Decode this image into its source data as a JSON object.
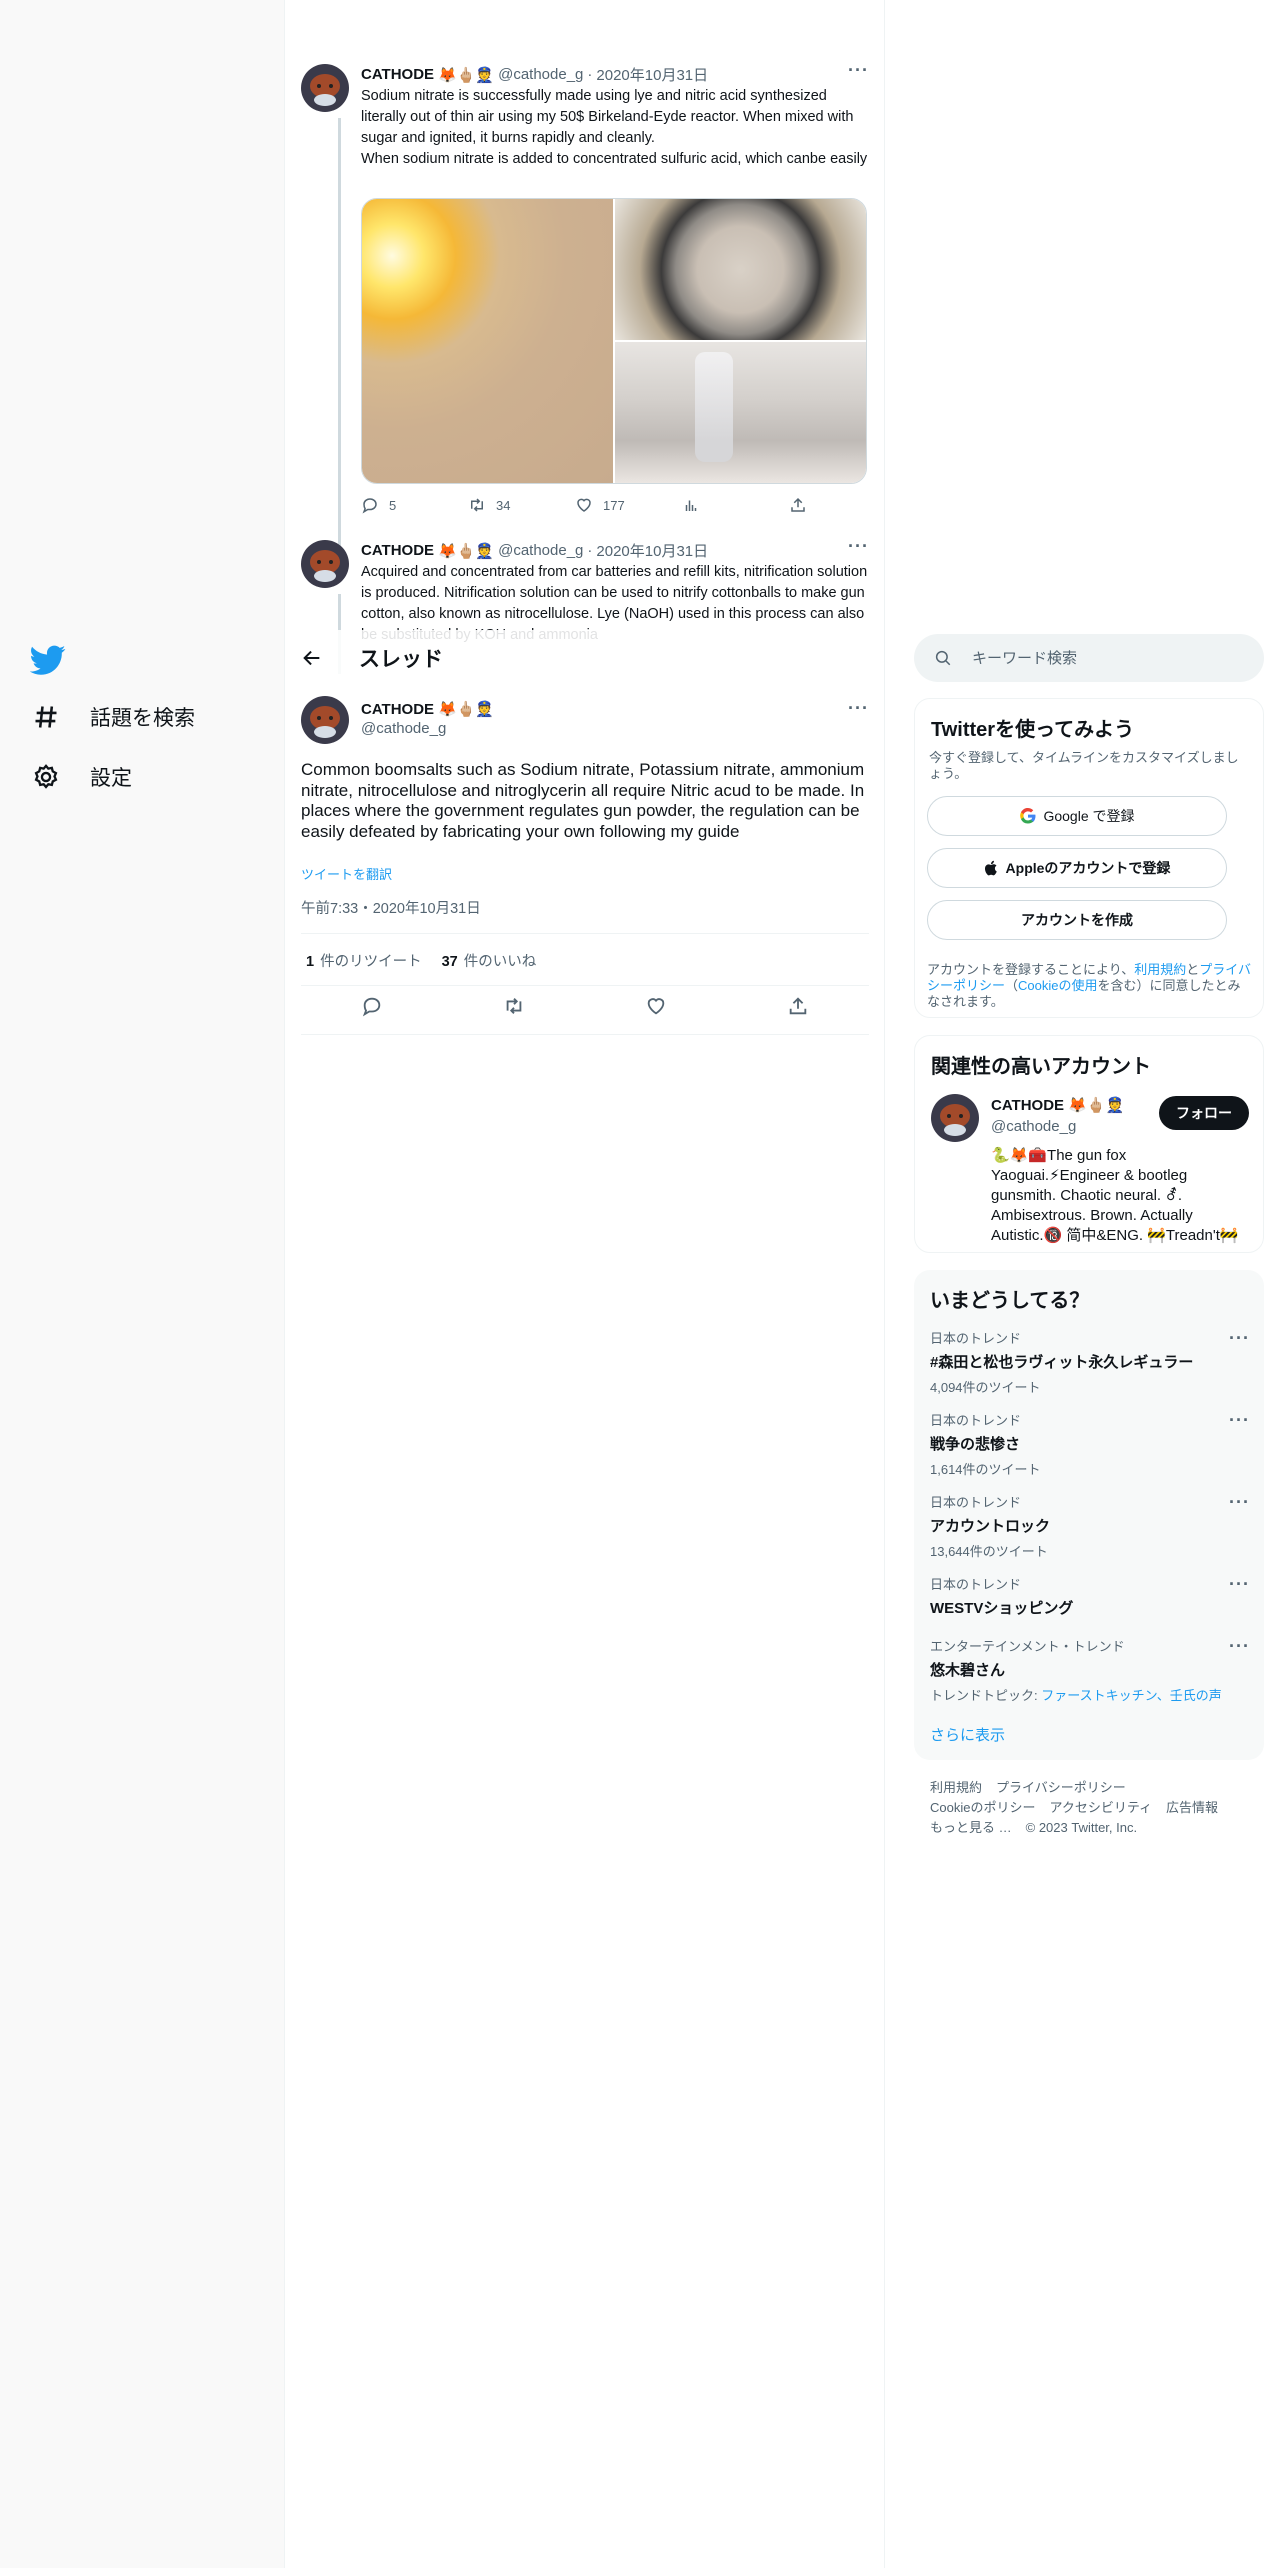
{
  "nav": {
    "items": [
      {
        "label": "話題を検索",
        "icon": "hashtag-icon"
      },
      {
        "label": "設定",
        "icon": "gear-icon"
      }
    ]
  },
  "tweets": [
    {
      "name": "CATHODE",
      "emoji": "🦊🖕🏼👮",
      "handle": "@cathode_g",
      "date": "2020年10月31日",
      "text": "Sodium nitrate is successfully made using lye and nitric acid synthesized literally out of thin air using my 50$ Birkeland-Eyde reactor. When mixed with sugar and ignited, it burns rapidly and cleanly.\nWhen sodium nitrate is added to concentrated sulfuric acid, which canbe easily",
      "replies": "5",
      "retweets": "34",
      "likes": "177"
    },
    {
      "name": "CATHODE",
      "emoji": "🦊🖕🏼👮",
      "handle": "@cathode_g",
      "date": "2020年10月31日",
      "text": "Acquired and concentrated from car batteries and refill kits, nitrification solution is produced. Nitrification solution can be used to nitrify cottonballs to make gun cotton, also known as nitrocellulose. Lye (NaOH) used in this process can also be substituted by KOH and ammonia"
    }
  ],
  "thread": {
    "title": "スレッド",
    "main": {
      "name": "CATHODE",
      "emoji": "🦊🖕🏼👮",
      "handle": "@cathode_g",
      "text": "Common boomsalts such as Sodium nitrate, Potassium nitrate, ammonium nitrate, nitrocellulose and nitroglycerin all require Nitric acud to be made. In places where the government regulates gun powder, the regulation can be easily defeated by fabricating your own following my guide",
      "translate": "ツイートを翻訳",
      "timestamp": "午前7:33・2020年10月31日",
      "retweet_count": "1",
      "retweet_label": "件のリツイート",
      "like_count": "37",
      "like_label": "件のいいね"
    }
  },
  "search": {
    "placeholder": "キーワード検索"
  },
  "signup": {
    "title": "Twitterを使ってみよう",
    "subtitle": "今すぐ登録して、タイムラインをカスタマイズしましょう。",
    "google": "Google で登録",
    "apple": "Appleのアカウントで登録",
    "create": "アカウントを作成",
    "legal_1": "アカウントを登録することにより、",
    "terms": "利用規約",
    "and": "と",
    "privacy": "プライバシーポリシー",
    "paren_open": "（",
    "cookie": "Cookieの使用",
    "legal_2": "を含む）に同意したとみなされます。"
  },
  "relevant": {
    "title": "関連性の高いアカウント",
    "name": "CATHODE",
    "emoji": "🦊🖕🏼👮",
    "handle": "@cathode_g",
    "follow": "フォロー",
    "bio": "🐍🦊🧰The gun fox Yaoguai.⚡Engineer & bootleg gunsmith. Chaotic neural. ⚦. Ambisextrous. Brown. Actually Autistic.🔞 简中&ENG. 🚧Treadn't🚧"
  },
  "trends": {
    "title": "いまどうしてる？",
    "items": [
      {
        "context": "日本のトレンド",
        "name": "#森田と松也ラヴィット永久レギュラー",
        "count": "4,094件のツイート"
      },
      {
        "context": "日本のトレンド",
        "name": "戦争の悲惨さ",
        "count": "1,614件のツイート"
      },
      {
        "context": "日本のトレンド",
        "name": "アカウントロック",
        "count": "13,644件のツイート"
      },
      {
        "context": "日本のトレンド",
        "name": "WESTVショッピング",
        "count": ""
      },
      {
        "context": "エンターテインメント・トレンド",
        "name": "悠木碧さん",
        "topic_prefix": "トレンドトピック: ",
        "topics": "ファーストキッチン、壬氏の声"
      }
    ],
    "show_more": "さらに表示"
  },
  "footer": {
    "terms": "利用規約",
    "privacy": "プライバシーポリシー",
    "cookie": "Cookieのポリシー",
    "accessibility": "アクセシビリティ",
    "ads": "広告情報",
    "more": "もっと見る …",
    "copyright": "© 2023 Twitter, Inc."
  },
  "colors": {
    "accent": "#1d9bf0",
    "text": "#0f1419",
    "muted": "#536471"
  }
}
